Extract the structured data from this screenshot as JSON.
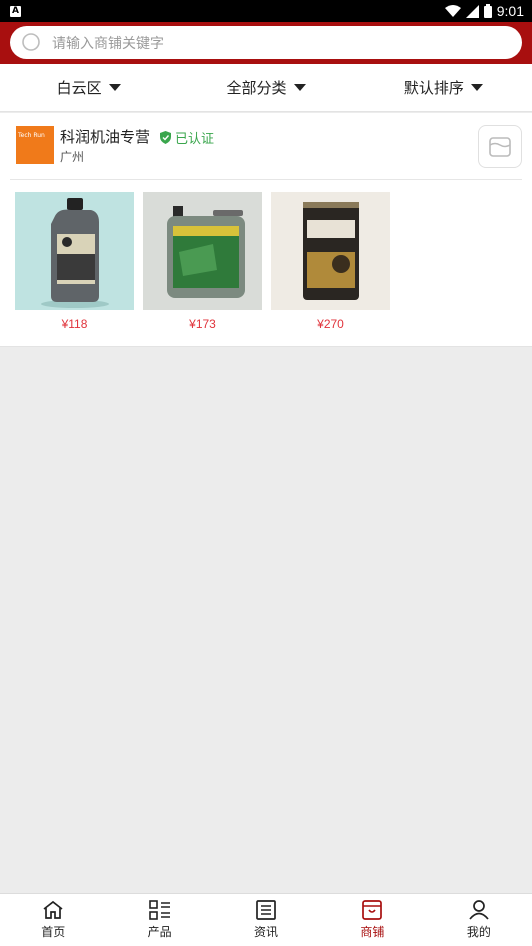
{
  "status_bar": {
    "time": "9:01",
    "notification_badge": "A"
  },
  "search": {
    "placeholder": "请输入商铺关键字"
  },
  "filters": [
    {
      "label": "白云区"
    },
    {
      "label": "全部分类"
    },
    {
      "label": "默认排序"
    }
  ],
  "store": {
    "name": "科润机油专营",
    "verified_label": "已认证",
    "city": "广州",
    "logo_text": "Tech Run",
    "products": [
      {
        "price": "¥118",
        "image": "oil-bottle-gray"
      },
      {
        "price": "¥173",
        "image": "oil-can-green-tech-run"
      },
      {
        "price": "¥270",
        "image": "power-factor-tin"
      }
    ]
  },
  "bottom_nav": [
    {
      "label": "首页",
      "icon": "home-icon"
    },
    {
      "label": "产品",
      "icon": "grid-list-icon"
    },
    {
      "label": "资讯",
      "icon": "news-icon"
    },
    {
      "label": "商铺",
      "icon": "shop-icon",
      "active": true
    },
    {
      "label": "我的",
      "icon": "user-icon"
    }
  ],
  "colors": {
    "brand": "#a80f0f",
    "price": "#e0333b",
    "verified": "#3aa64d"
  }
}
